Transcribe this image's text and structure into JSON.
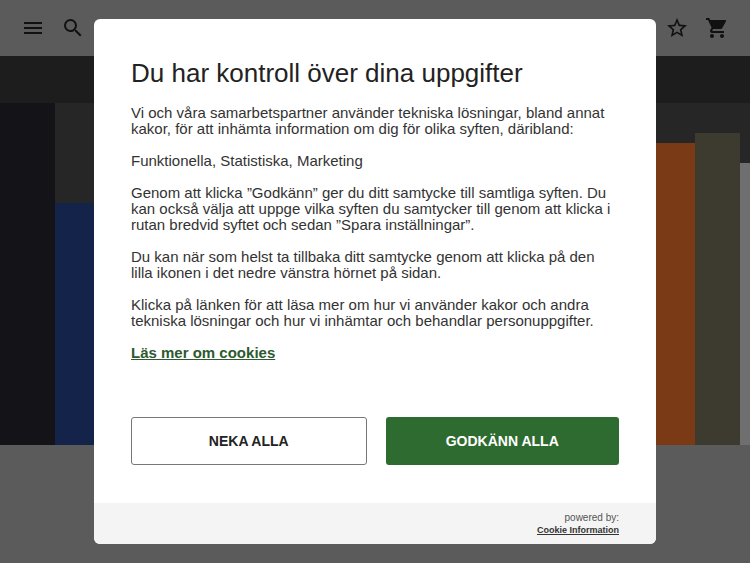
{
  "dialog": {
    "title": "Du har kontroll över dina uppgifter",
    "intro": "Vi och våra samarbetspartner använder tekniska lösningar, bland annat kakor, för att inhämta information om dig för olika syften, däribland:",
    "purposes": "Funktionella, Statistiska, Marketing",
    "paragraphs": [
      "Genom att klicka ”Godkänn” ger du ditt samtycke till samtliga syften. Du kan också välja att uppge vilka syften du samtycker till genom att klicka i rutan bredvid syftet och sedan ”Spara inställningar”.",
      "Du kan när som helst ta tillbaka ditt samtycke genom att klicka på den lilla ikonen i det nedre vänstra hörnet på sidan.",
      "Klicka på länken för att läsa mer om hur vi använder kakor och andra tekniska lösningar och hur vi inhämtar och behandlar personuppgifter."
    ],
    "link": "Läs mer om cookies",
    "buttons": [
      {
        "label": "NEKA ALLA",
        "kind": "secondary"
      },
      {
        "label": "GODKÄNN ALLA",
        "kind": "primary"
      }
    ],
    "footer": {
      "powered_by": "powered by:",
      "brand": "Cookie Information"
    }
  }
}
